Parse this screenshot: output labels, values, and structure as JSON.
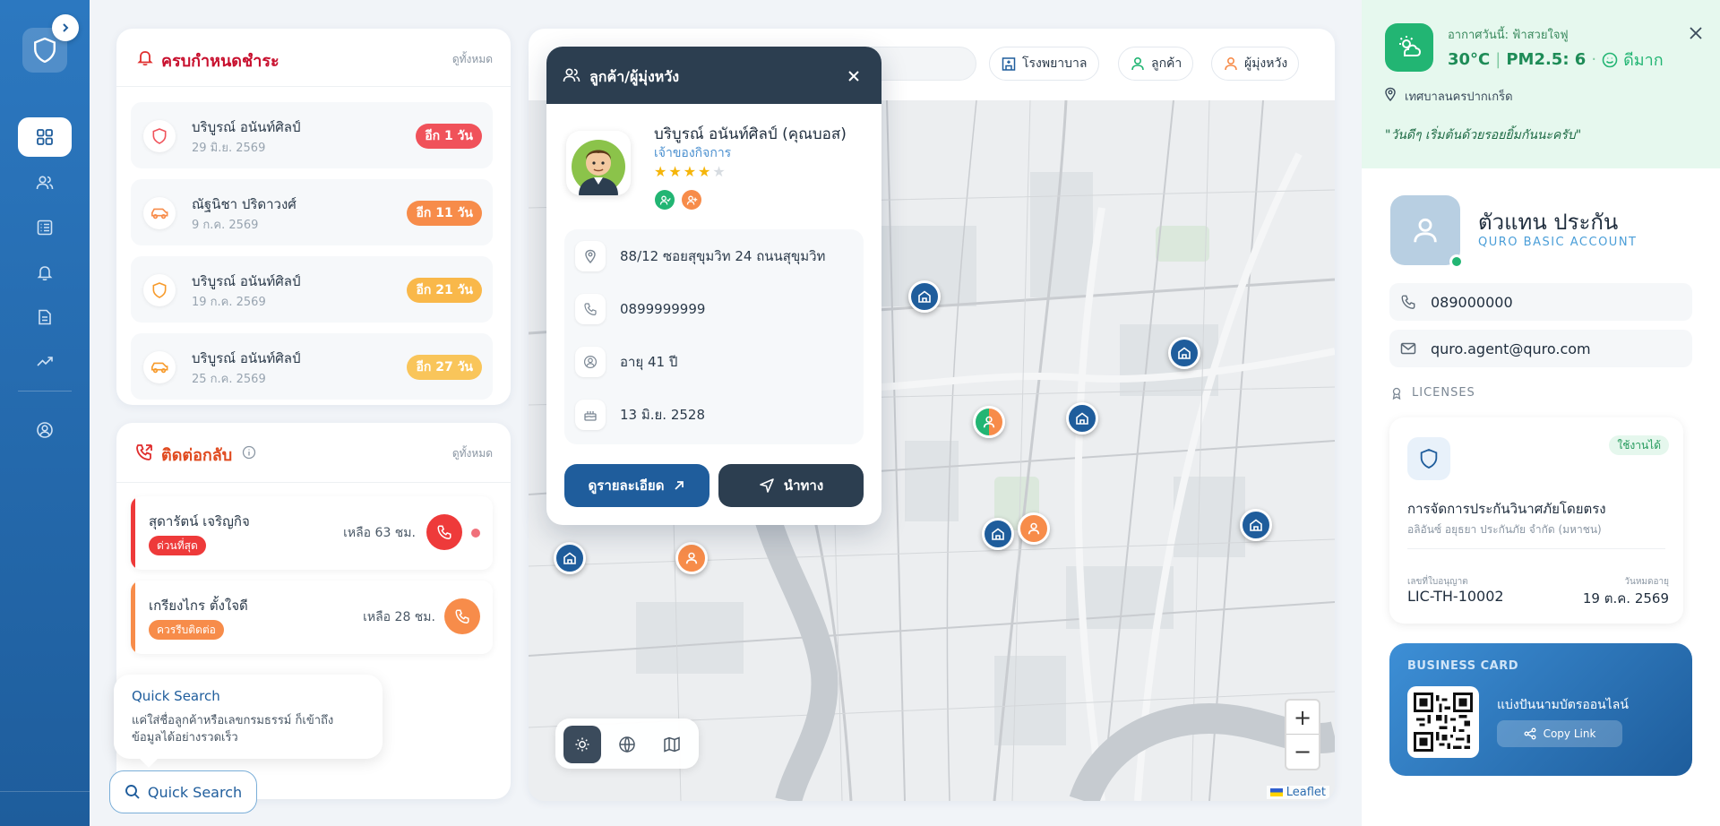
{
  "due": {
    "title": "ครบกำหนดชำระ",
    "view_all": "ดูทั้งหมด",
    "items": [
      {
        "name": "บริบูรณ์ อนันท์ศิลป์",
        "date": "29 มิ.ย. 2569",
        "badge": "อีก 1 วัน",
        "badge_color": "#f0525a",
        "icon": "shield-icon",
        "icon_color": "#f0525a"
      },
      {
        "name": "ณัฐนิชา ปริดาวงศ์",
        "date": "9 ก.ค. 2569",
        "badge": "อีก 11 วัน",
        "badge_color": "#f78c4a",
        "icon": "car-icon",
        "icon_color": "#f78c4a"
      },
      {
        "name": "บริบูรณ์ อนันท์ศิลป์",
        "date": "19 ก.ค. 2569",
        "badge": "อีก 21 วัน",
        "badge_color": "#f9b84a",
        "icon": "shield-icon",
        "icon_color": "#f79a2a"
      },
      {
        "name": "บริบูรณ์ อนันท์ศิลป์",
        "date": "25 ก.ค. 2569",
        "badge": "อีก 27 วัน",
        "badge_color": "#f9c55a",
        "icon": "car-icon",
        "icon_color": "#f79a2a"
      }
    ]
  },
  "callback": {
    "title": "ติดต่อกลับ",
    "view_all": "ดูทั้งหมด",
    "items": [
      {
        "name": "สุดารัตน์ เจริญกิจ",
        "tag": "ด่วนที่สุด",
        "remain": "เหลือ 63 ชม.",
        "color": "#ee3a3a"
      },
      {
        "name": "เกรียงไกร ตั้งใจดี",
        "tag": "ควรรีบติดต่อ",
        "remain": "เหลือ 28 ชม.",
        "color": "#f78c4a"
      }
    ]
  },
  "quick_search": {
    "tip_title": "Quick Search",
    "tip_line1": "แค่ใส่ชื่อลูกค้าหรือเลขกรมธรรม์ ก็เข้าถึง",
    "tip_line2": "ข้อมูลได้อย่างรวดเร็ว",
    "button_label": "Quick Search"
  },
  "map": {
    "filters": {
      "hospital": "โรงพยาบาล",
      "customer": "ลูกค้า",
      "prospect": "ผู้มุ่งหวัง"
    },
    "zoom_in": "+",
    "zoom_out": "−",
    "attribution": "Leaflet"
  },
  "popup": {
    "title": "ลูกค้า/ผู้มุ่งหวัง",
    "name": "บริบูรณ์ อนันท์ศิลป์ (คุณบอส)",
    "role": "เจ้าของกิจการ",
    "rating": 4,
    "rating_max": 5,
    "address": "88/12 ซอยสุขุมวิท 24 ถนนสุขุมวิท",
    "phone": "0899999999",
    "age": "อายุ 41 ปี",
    "birthday": "13 มิ.ย. 2528",
    "detail_button": "ดูรายละเอียด",
    "navigate_button": "นำทาง"
  },
  "weather": {
    "label": "อากาศวันนี้: ฟ้าสวยใจฟู",
    "temp": "30°C",
    "pm": "PM2.5: 6",
    "quality": "ดีมาก",
    "location": "เทศบาลนครปากเกร็ด",
    "quote": "\"วันดีๆ เริ่มต้นด้วยรอยยิ้มกันนะครับ\""
  },
  "profile": {
    "name": "ตัวแทน ประกัน",
    "account": "QURO BASIC ACCOUNT",
    "phone": "089000000",
    "email": "quro.agent@quro.com"
  },
  "licenses": {
    "heading": "LICENSES",
    "status": "ใช้งานได้",
    "title": "การจัดการประกันวินาศภัยโดยตรง",
    "company": "อลิอันซ์ อยุธยา ประกันภัย จำกัด (มหาชน)",
    "number_label": "เลขที่ใบอนุญาต",
    "number": "LIC-TH-10002",
    "expiry_label": "วันหมดอายุ",
    "expiry": "19 ต.ค. 2569"
  },
  "business_card": {
    "heading": "BUSINESS CARD",
    "share_text": "แบ่งปันนามบัตรออนไลน์",
    "copy_label": "Copy Link"
  },
  "colors": {
    "primary": "#1f5d9c",
    "dark": "#2c3e50",
    "green": "#22b573",
    "orange": "#f78c4a",
    "red": "#ee3a3a"
  }
}
